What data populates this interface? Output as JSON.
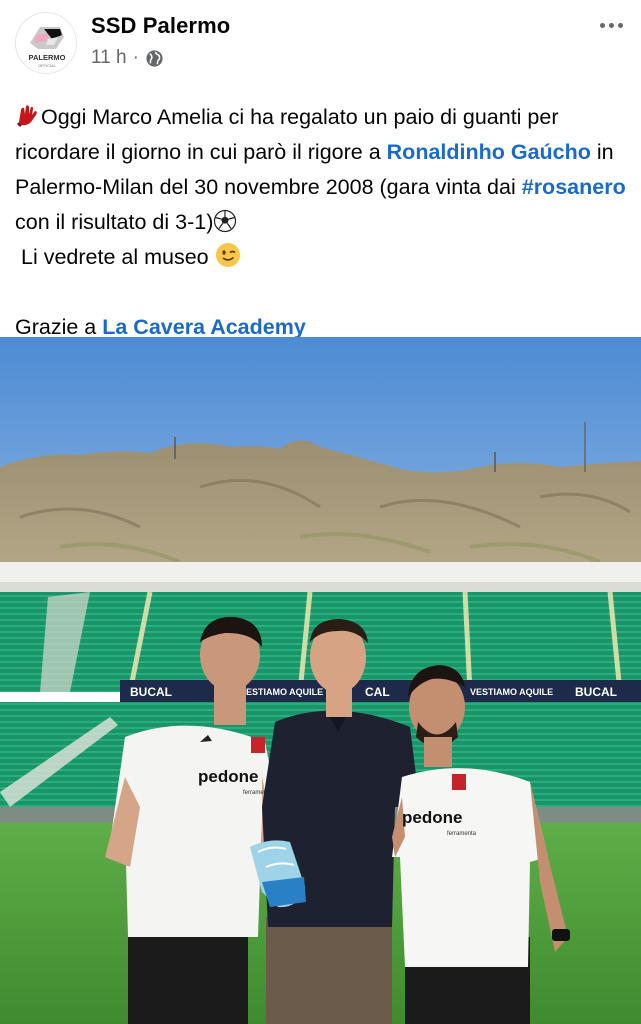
{
  "post": {
    "page_name": "SSD Palermo",
    "time": "11 h",
    "audience_icon": "globe-icon",
    "more_icon": "more-dots-icon",
    "avatar": {
      "logo_text": "PALERMO",
      "logo_subtext": "OFFICIAL"
    },
    "text": {
      "line1_prefix": "Oggi Marco Amelia ci ha regalato un paio di guanti per ricordare il giorno in cui parò il rigore a ",
      "mention": "Ronaldinho Gaúcho",
      "line1_mid": " in Palermo-Milan del 30 novembre 2008 (gara vinta dai ",
      "hashtag": "#rosanero",
      "line1_suffix": " con il risultato di 3-1)",
      "line2": "Li vedrete al museo ",
      "thanks_prefix": "Grazie a ",
      "thanks_link": "La Cavera Academy"
    },
    "photo": {
      "banner_texts": [
        "BUCAL",
        "VESTIAMO AQUILE",
        "CAL",
        "VESTIAMO AQUILE",
        "BUCAL"
      ],
      "shirt_text": "pedone",
      "shirt_subtext": "ferramenta"
    }
  },
  "colors": {
    "link": "#1b6ac9",
    "meta": "#65676b",
    "sky": "#5b95d6",
    "grass": "#4f9a3a",
    "seats": "#1f9d6c"
  }
}
